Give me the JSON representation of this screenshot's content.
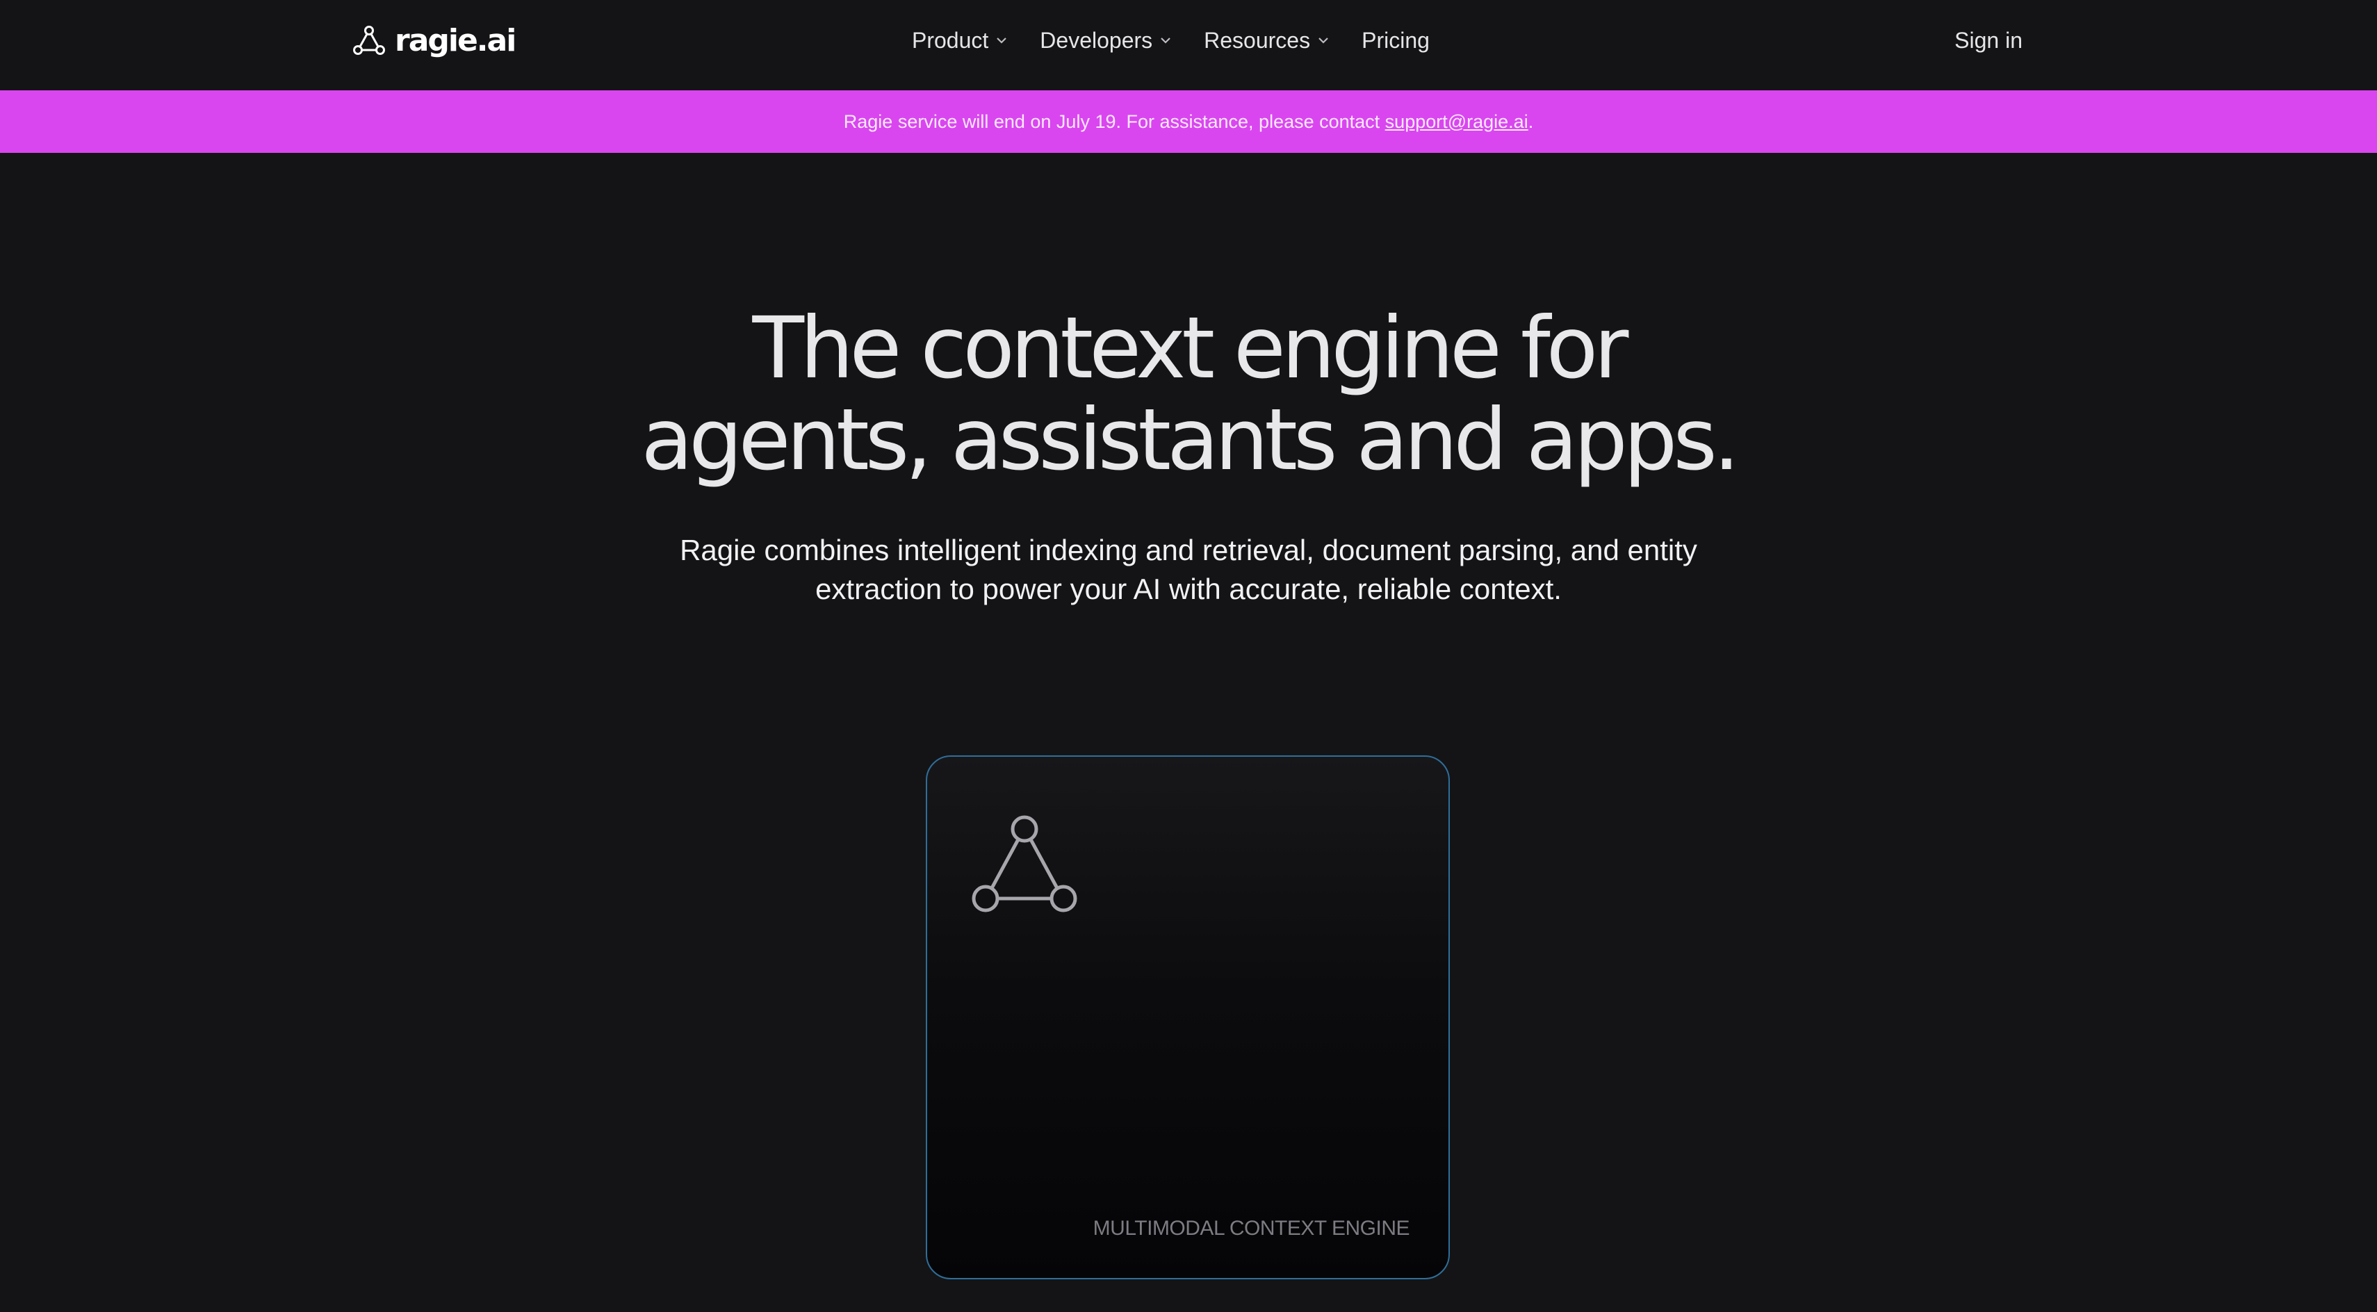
{
  "navbar": {
    "logo_text": "ragie.ai",
    "links": [
      {
        "label": "Product"
      },
      {
        "label": "Developers"
      },
      {
        "label": "Resources"
      },
      {
        "label": "Pricing"
      }
    ],
    "signin_label": "Sign in"
  },
  "banner": {
    "text_before": "Ragie service will end on July 19. For assistance, please contact ",
    "link_text": "support@ragie.ai",
    "text_after": "."
  },
  "hero": {
    "title_line1": "The context engine for",
    "title_line2": "agents, assistants and apps.",
    "subtitle_line1": "Ragie combines intelligent indexing and retrieval, document parsing, and entity",
    "subtitle_line2": "extraction to power your AI with accurate, reliable context."
  },
  "card": {
    "label": "MULTIMODAL CONTEXT ENGINE",
    "icon": "triangle-nodes-icon"
  },
  "colors": {
    "background": "#141416",
    "banner": "#d946ef",
    "card_border": "#2f6e9a"
  }
}
